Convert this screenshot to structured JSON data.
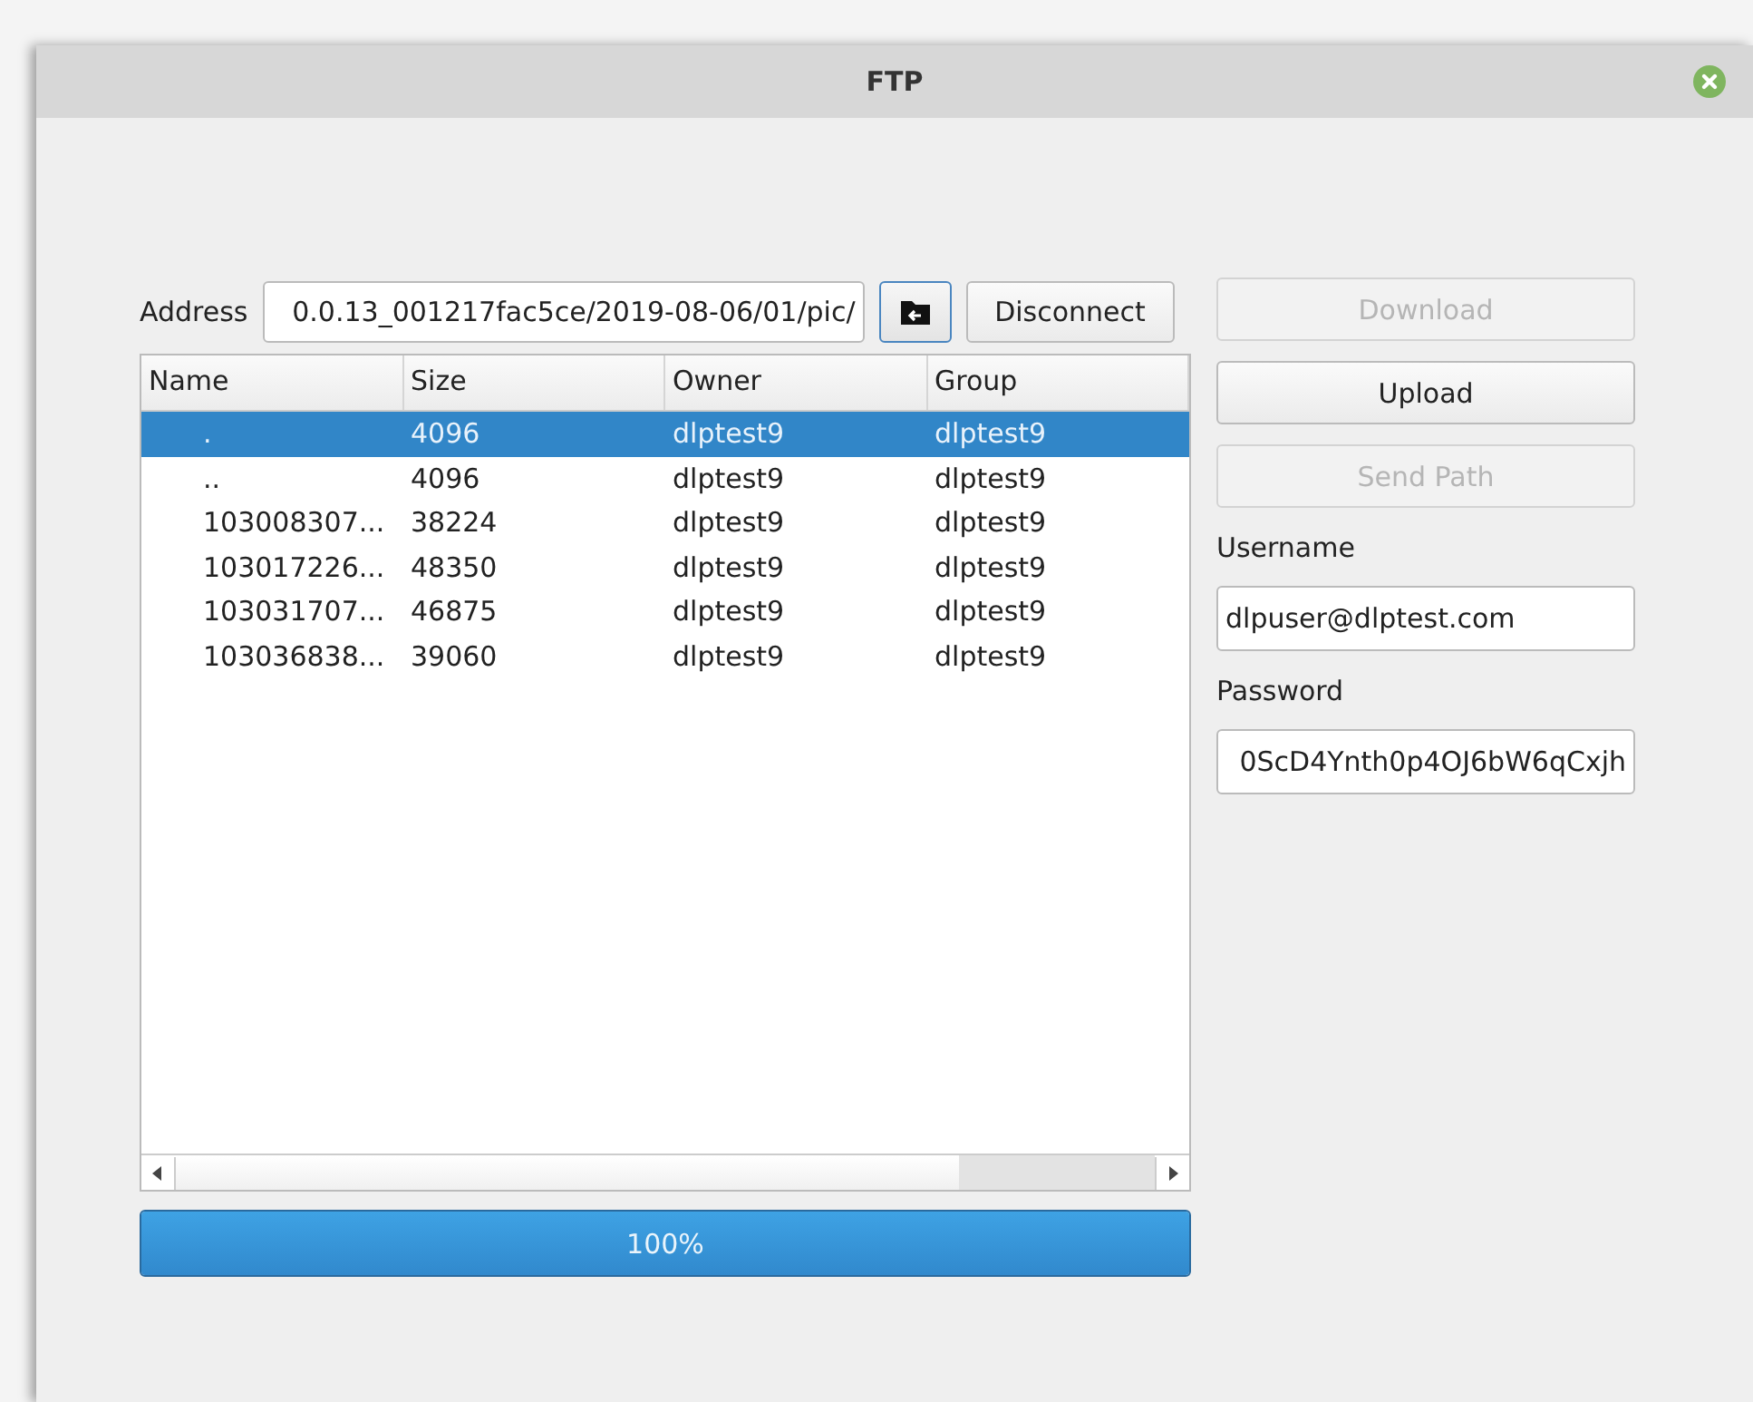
{
  "window": {
    "title": "FTP"
  },
  "address": {
    "label": "Address",
    "value": "0.0.13_001217fac5ce/2019-08-06/01/pic/"
  },
  "disconnect_button": "Disconnect",
  "table": {
    "columns": [
      "Name",
      "Size",
      "Owner",
      "Group"
    ],
    "rows": [
      {
        "cells": [
          ".",
          "4096",
          "dlptest9",
          "dlptest9"
        ],
        "selected": true
      },
      {
        "cells": [
          "..",
          "4096",
          "dlptest9",
          "dlptest9"
        ],
        "selected": false
      },
      {
        "cells": [
          "103008307...",
          "38224",
          "dlptest9",
          "dlptest9"
        ],
        "selected": false
      },
      {
        "cells": [
          "103017226...",
          "48350",
          "dlptest9",
          "dlptest9"
        ],
        "selected": false
      },
      {
        "cells": [
          "103031707...",
          "46875",
          "dlptest9",
          "dlptest9"
        ],
        "selected": false
      },
      {
        "cells": [
          "103036838...",
          "39060",
          "dlptest9",
          "dlptest9"
        ],
        "selected": false
      }
    ]
  },
  "progress": {
    "level": 1.0,
    "text": "100%"
  },
  "buttons": [
    {
      "label": "Download",
      "disabled": true
    },
    {
      "label": "Upload",
      "disabled": false
    },
    {
      "label": "Send Path",
      "disabled": true
    }
  ],
  "username": {
    "label": "Username",
    "value": "dlpuser@dlptest.com"
  },
  "password": {
    "label": "Password",
    "value": "0ScD4Ynth0p4OJ6bW6qCxjh"
  }
}
